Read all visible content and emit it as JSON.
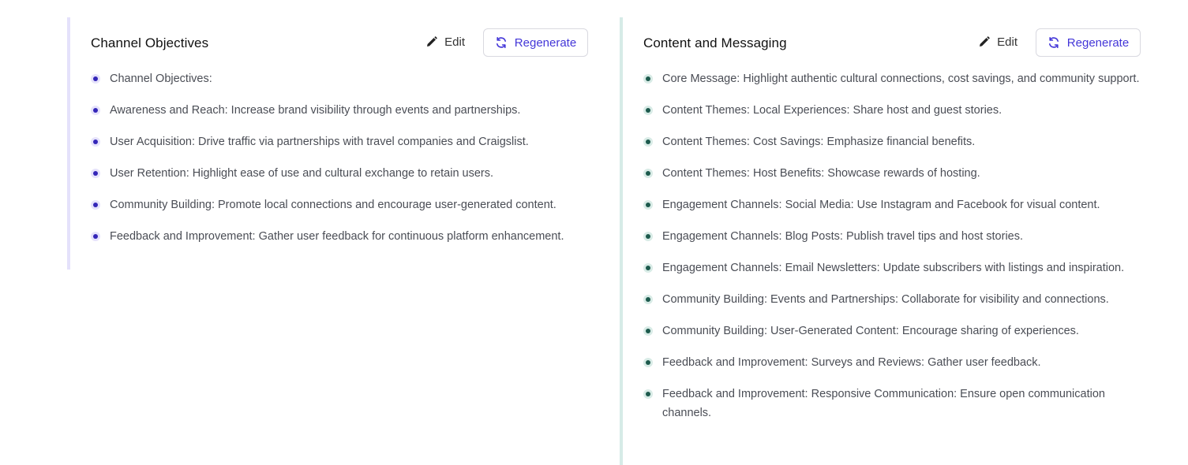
{
  "panels": [
    {
      "title": "Channel Objectives",
      "edit_label": "Edit",
      "regenerate_label": "Regenerate",
      "items": [
        "Channel Objectives:",
        "Awareness and Reach: Increase brand visibility through events and partnerships.",
        "User Acquisition: Drive traffic via partnerships with travel companies and Craigslist.",
        "User Retention: Highlight ease of use and cultural exchange to retain users.",
        "Community Building: Promote local connections and encourage user-generated content.",
        "Feedback and Improvement: Gather user feedback for continuous platform enhancement."
      ]
    },
    {
      "title": "Content and Messaging",
      "edit_label": "Edit",
      "regenerate_label": "Regenerate",
      "items": [
        "Core Message: Highlight authentic cultural connections, cost savings, and community support.",
        "Content Themes: Local Experiences: Share host and guest stories.",
        "Content Themes: Cost Savings: Emphasize financial benefits.",
        "Content Themes: Host Benefits: Showcase rewards of hosting.",
        "Engagement Channels: Social Media: Use Instagram and Facebook for visual content.",
        "Engagement Channels: Blog Posts: Publish travel tips and host stories.",
        "Engagement Channels: Email Newsletters: Update subscribers with listings and inspiration.",
        "Community Building: Events and Partnerships: Collaborate for visibility and connections.",
        "Community Building: User-Generated Content: Encourage sharing of experiences.",
        "Feedback and Improvement: Surveys and Reviews: Gather user feedback.",
        "Feedback and Improvement: Responsive Communication: Ensure open communication channels."
      ]
    }
  ],
  "icons": {
    "edit": "pencil-icon",
    "regenerate": "refresh-icon"
  },
  "colors": {
    "accent": "#4336d8",
    "left_bullet": "#3426b8",
    "right_bullet": "#1d5a4d"
  }
}
